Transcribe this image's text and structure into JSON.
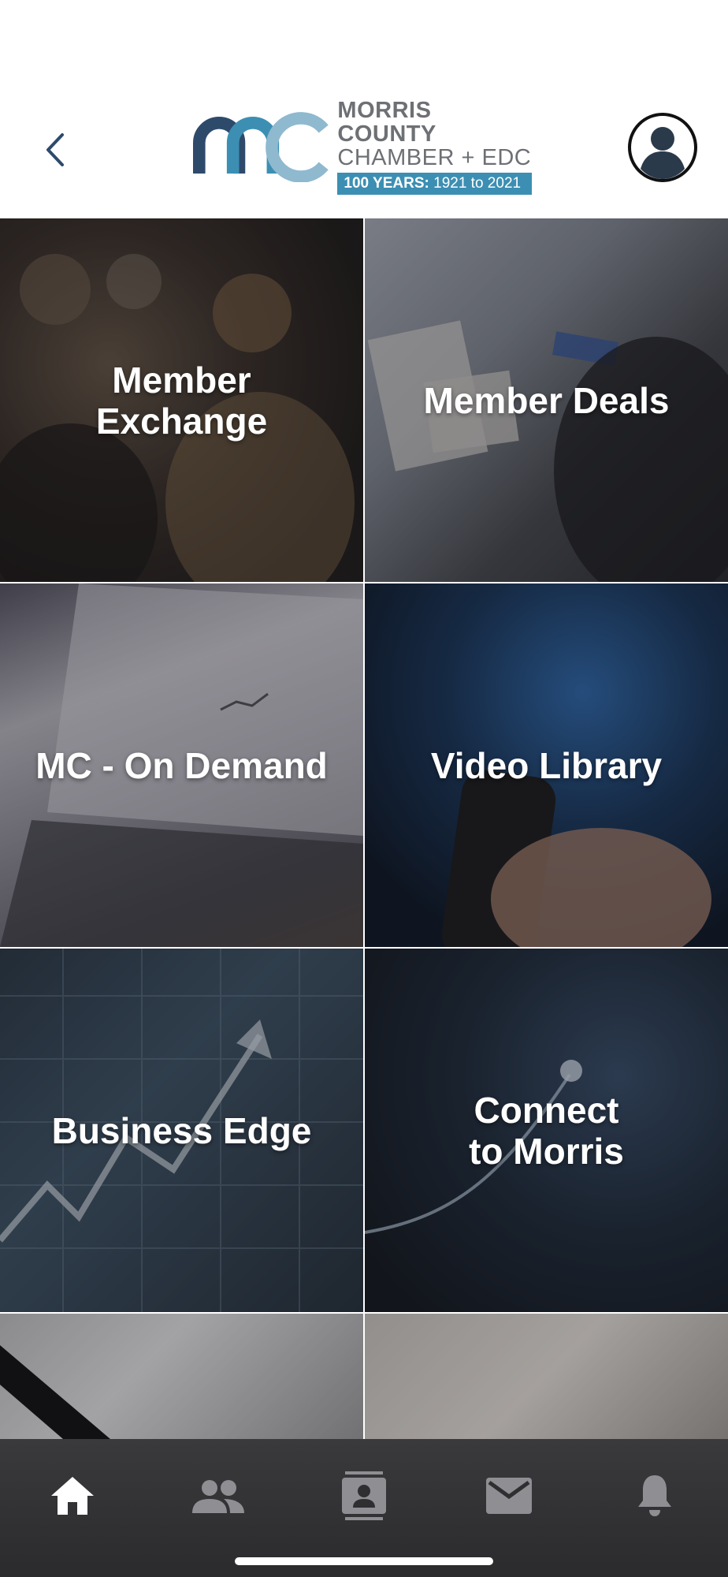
{
  "header": {
    "back_label": "Back",
    "logo": {
      "line1": "MORRIS COUNTY",
      "line2": "CHAMBER + EDC",
      "badge_bold": "100 YEARS:",
      "badge_rest": " 1921 to 2021",
      "colors": {
        "dark_blue": "#2e4a6b",
        "mid_blue": "#3c8fb3",
        "light_blue": "#8fb9cf",
        "gray": "#6d7074"
      }
    },
    "avatar_icon": "user-circle-icon"
  },
  "tiles": [
    {
      "label": "Member\nExchange"
    },
    {
      "label": "Member Deals"
    },
    {
      "label": "MC - On Demand"
    },
    {
      "label": "Video Library"
    },
    {
      "label": "Business Edge"
    },
    {
      "label": "Connect\nto Morris"
    },
    {
      "label": ""
    },
    {
      "label": ""
    }
  ],
  "tabbar": {
    "items": [
      {
        "icon": "home-icon",
        "active": true
      },
      {
        "icon": "people-icon",
        "active": false
      },
      {
        "icon": "contact-card-icon",
        "active": false
      },
      {
        "icon": "mail-icon",
        "active": false
      },
      {
        "icon": "bell-icon",
        "active": false
      }
    ],
    "active_color": "#ffffff",
    "inactive_color": "#8e8e93"
  }
}
